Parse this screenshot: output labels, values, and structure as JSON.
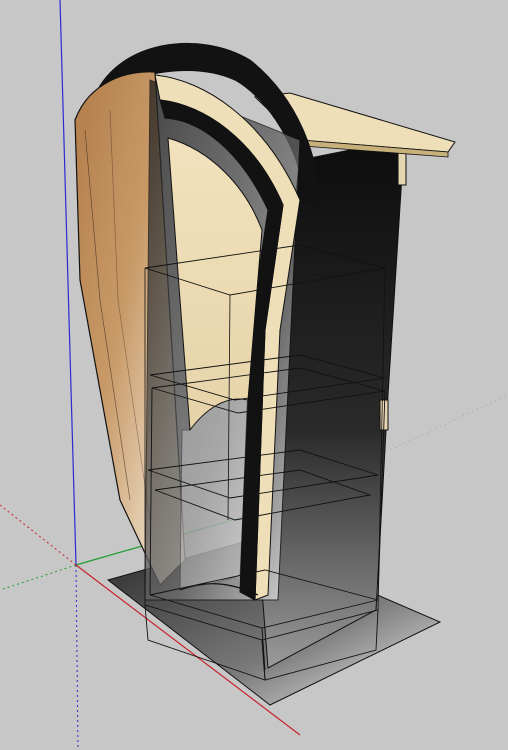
{
  "viewport": {
    "background": "#c7c7c7",
    "axis_colors": {
      "red": "#c8232b",
      "green": "#1e9e2e",
      "blue": "#2b2bd0"
    }
  },
  "model": {
    "description_icon": "lectern-3d-model",
    "colors": {
      "edge": "#111111",
      "wood_light": "#eedfb8",
      "wood_mid": "#d7bf94",
      "wood_dark": "#8a5a33",
      "black_panel": "#121212",
      "shadow": "#4a4a4a"
    }
  }
}
